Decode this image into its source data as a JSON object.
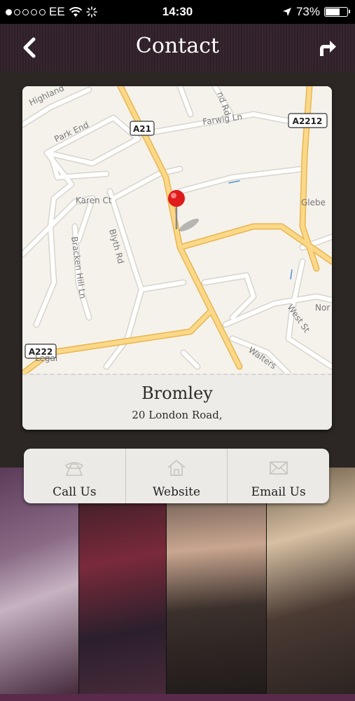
{
  "status_bar": {
    "carrier": "EE",
    "time": "14:30",
    "battery": "73%",
    "battery_level": 0.73,
    "signal_dots_filled": 1,
    "signal_dots_total": 5
  },
  "nav": {
    "title": "Contact",
    "back_icon": "back-arrow-icon",
    "share_icon": "share-arrow-icon"
  },
  "map": {
    "road_labels": {
      "a21": "A21",
      "a2212": "A2212",
      "a222": "A222"
    },
    "street_labels": {
      "highland": "Highland",
      "park_end": "Park End",
      "farwig": "Farwig Ln",
      "nd_rd": "nd Rd",
      "karen_ct": "Karen Ct",
      "blyth_rd": "Blyth Rd",
      "bracken": "Bracken Hill Ln",
      "glebe": "Glebe",
      "west_st": "West St",
      "nor": "Nor",
      "walters": "Walters",
      "legal": "Legal"
    },
    "pin_icon": "map-pin-icon"
  },
  "location": {
    "name": "Bromley",
    "address": "20 London Road,"
  },
  "actions": [
    {
      "label": "Call Us",
      "icon": "phone-icon"
    },
    {
      "label": "Website",
      "icon": "home-icon"
    },
    {
      "label": "Email Us",
      "icon": "envelope-icon"
    }
  ],
  "colors": {
    "navbar": "#2e1f28",
    "map_bg": "#f5f2ec",
    "road_major": "#f6d27a",
    "road_minor": "#ffffff",
    "pin": "#e01b1b"
  }
}
